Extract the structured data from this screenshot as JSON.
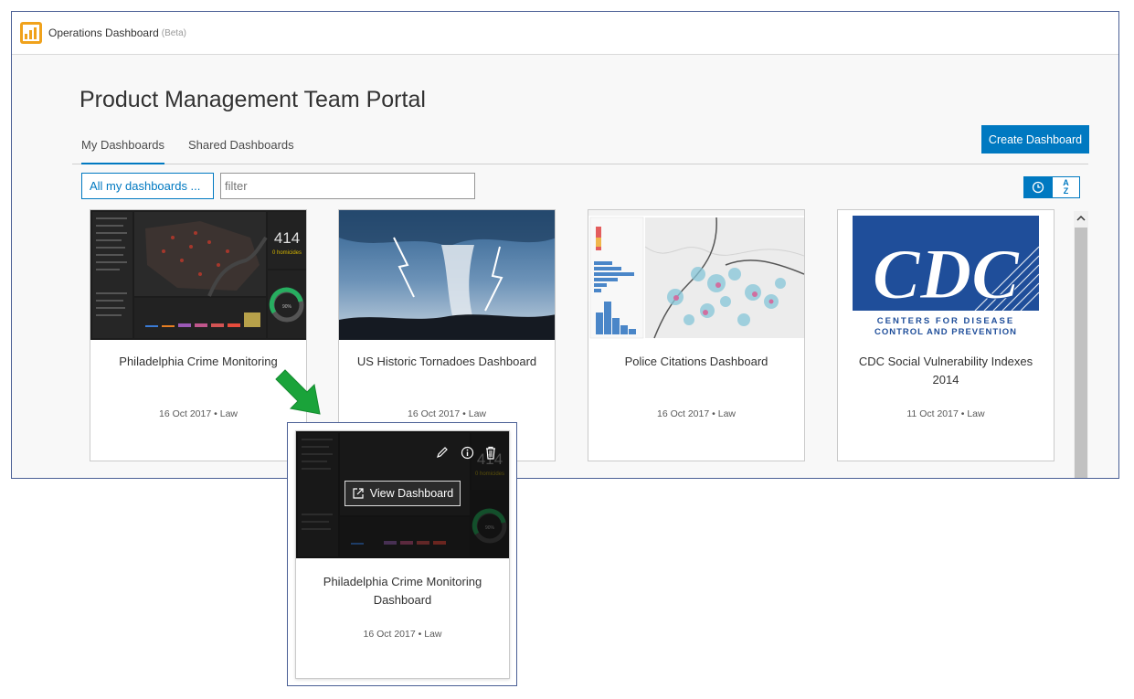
{
  "app": {
    "title": "Operations Dashboard",
    "badge": "(Beta)"
  },
  "portal": {
    "title": "Product Management Team Portal"
  },
  "tabs": [
    {
      "label": "My Dashboards",
      "active": true
    },
    {
      "label": "Shared Dashboards",
      "active": false
    }
  ],
  "actions": {
    "create_label": "Create Dashboard"
  },
  "filter": {
    "select_value": "All my dashboards  ...",
    "input_placeholder": "filter"
  },
  "sort": {
    "az_top": "A",
    "az_bottom": "Z"
  },
  "cards": [
    {
      "title": "Philadelphia Crime Monitoring",
      "date": "16 Oct 2017",
      "tag": "Law"
    },
    {
      "title": "US Historic Tornadoes Dashboard",
      "date": "16 Oct 2017",
      "tag": "Law"
    },
    {
      "title": "Police Citations Dashboard",
      "date": "16 Oct 2017",
      "tag": "Law"
    },
    {
      "title": "CDC Social Vulnerability Indexes 2014",
      "date": "11 Oct 2017",
      "tag": "Law"
    }
  ],
  "thumb_crime": {
    "count": "414",
    "sub": "0 homicides",
    "gauge": "90%"
  },
  "thumb_cdc": {
    "letters": "CDC",
    "line1": "CENTERS FOR DISEASE",
    "line2": "CONTROL AND PREVENTION"
  },
  "popup": {
    "title": "Philadelphia Crime Monitoring Dashboard",
    "date": "16 Oct 2017",
    "tag": "Law",
    "view_label": "View Dashboard"
  },
  "separator": "•",
  "colors": {
    "accent": "#0079c1",
    "arrow": "#1aa33a",
    "frame": "#4a5f95"
  }
}
